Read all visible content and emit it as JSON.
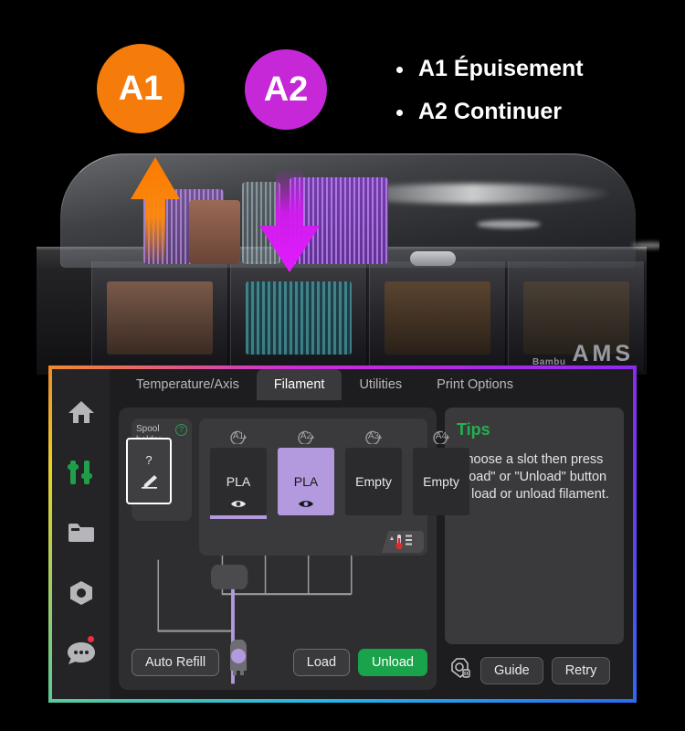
{
  "annotations": {
    "badges": [
      {
        "id": "a1",
        "label": "A1",
        "color": "#F57B0B"
      },
      {
        "id": "a2",
        "label": "A2",
        "color": "#C628D8"
      }
    ],
    "bullets": [
      "A1 Épuisement",
      "A2 Continuer"
    ],
    "arrows": [
      {
        "name": "up-arrow-a1",
        "direction": "up",
        "color": "#FF8A0A"
      },
      {
        "name": "down-arrow-a2",
        "direction": "down",
        "color": "#D21BEE"
      }
    ]
  },
  "device_photo": {
    "brand": "Bambu",
    "model": "AMS"
  },
  "panel": {
    "sidebar": {
      "items": [
        {
          "name": "home",
          "icon": "home-icon",
          "active": false
        },
        {
          "name": "control",
          "icon": "sliders-icon",
          "active": true
        },
        {
          "name": "files",
          "icon": "folder-icon",
          "active": false
        },
        {
          "name": "calibration",
          "icon": "nut-icon",
          "active": false
        },
        {
          "name": "messages",
          "icon": "chat-icon",
          "active": false,
          "badge": true
        }
      ]
    },
    "tabs": [
      {
        "label": "Temperature/Axis",
        "active": false
      },
      {
        "label": "Filament",
        "active": true
      },
      {
        "label": "Utilities",
        "active": false
      },
      {
        "label": "Print Options",
        "active": false
      }
    ],
    "spool_holder": {
      "label_line1": "Spool",
      "label_line2": "holder",
      "help_icon": "question-mark-icon",
      "value": "?",
      "edit_icon": "pencil-icon"
    },
    "slots": [
      {
        "id": "A1",
        "material": "PLA",
        "selected": false,
        "color": "#b39adf",
        "eye_icon": "eye-icon",
        "badge_icon": "rotate-arrow-icon"
      },
      {
        "id": "A2",
        "material": "PLA",
        "selected": true,
        "color": "#b39adf",
        "eye_icon": "eye-icon",
        "badge_icon": "rotate-arrow-icon"
      },
      {
        "id": "A3",
        "material": "Empty",
        "selected": false,
        "color": "",
        "eye_icon": "",
        "badge_icon": "rotate-arrow-icon"
      },
      {
        "id": "A4",
        "material": "Empty",
        "selected": false,
        "color": "",
        "eye_icon": "",
        "badge_icon": "rotate-arrow-icon"
      }
    ],
    "humidity_icon": "humidity-thermometer-icon",
    "extruder_icon": "extruder-icon",
    "buttons": {
      "auto_refill": "Auto Refill",
      "load": "Load",
      "unload": "Unload",
      "guide": "Guide",
      "retry": "Retry",
      "nozzle_icon": "nozzle-icon"
    },
    "tips": {
      "title": "Tips",
      "text": "Choose a slot then press \"Load\" or \"Unload\" button to load or unload filament."
    },
    "accent_colors": {
      "unload_green": "#19A34A",
      "tips_green": "#25B050",
      "selected_purple": "#b39adf",
      "alert_red": "#F0303A"
    }
  }
}
